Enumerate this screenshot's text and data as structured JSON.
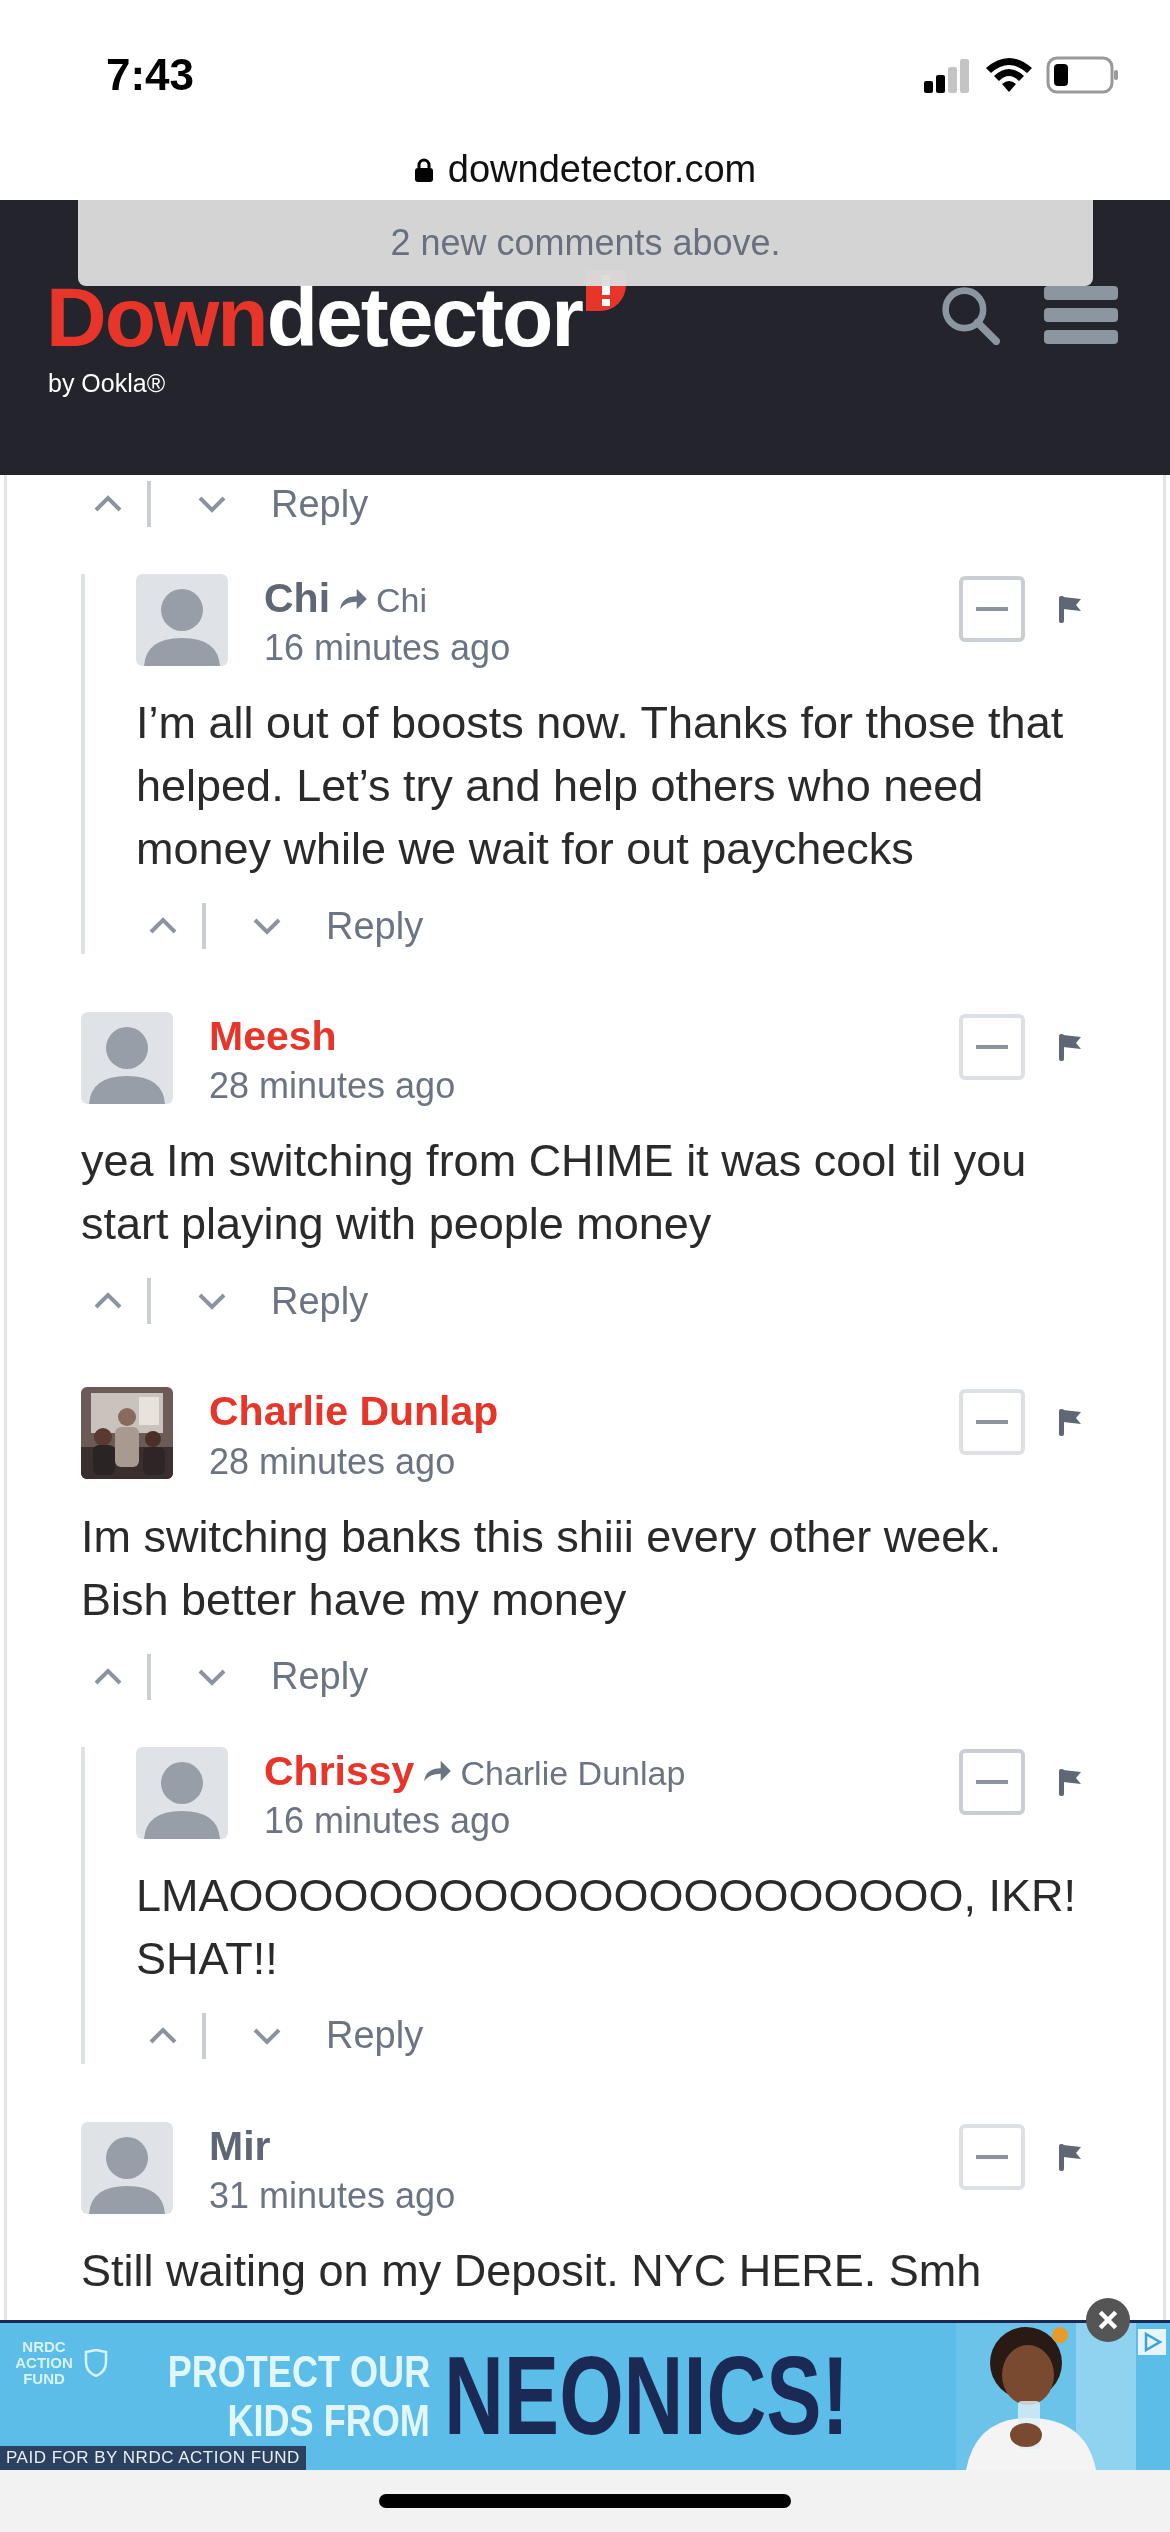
{
  "status_bar": {
    "time": "7:43"
  },
  "url_bar": {
    "url": "downdetector.com"
  },
  "header": {
    "logo_accent": "Down",
    "logo_main": "detector",
    "logo_sub": "by Ookla®"
  },
  "toast": {
    "text": "2 new comments above."
  },
  "comments": [
    {
      "reply": "Reply",
      "children": [
        {
          "author": "Chi",
          "color": "#5f6775",
          "reply_to": "Chi",
          "time": "16 minutes ago",
          "text": "I’m all out of boosts now. Thanks for those that helped. Let’s try and help others who need money while we wait for out paychecks",
          "reply": "Reply"
        }
      ]
    },
    {
      "author": "Meesh",
      "color": "#e8352a",
      "time": "28 minutes ago",
      "text": "yea Im switching from CHIME it was cool til you start playing with people money",
      "reply": "Reply"
    },
    {
      "author": "Charlie Dunlap",
      "color": "#e8352a",
      "avatar": {
        "kind": "picture"
      },
      "time": "28 minutes ago",
      "text": "Im switching banks this shiii every other week. Bish better have my money",
      "reply": "Reply",
      "children": [
        {
          "author": "Chrissy",
          "color": "#e8352a",
          "reply_to": "Charlie Dunlap",
          "time": "16 minutes ago",
          "text": "LMAOOOOOOOOOOOOOOOOOOOOO, IKR! SHAT!!",
          "reply": "Reply"
        }
      ]
    },
    {
      "author": "Mir",
      "color": "#5f6775",
      "time": "31 minutes ago",
      "text": "Still waiting on my Deposit. NYC HERE. Smh"
    }
  ],
  "ad": {
    "logo": "NRDC ACTION FUND",
    "headline": [
      "PROTECT OUR",
      "KIDS FROM"
    ],
    "headline_big": "NEONICS!",
    "disclaimer": "PAID FOR BY NRDC ACTION FUND"
  }
}
